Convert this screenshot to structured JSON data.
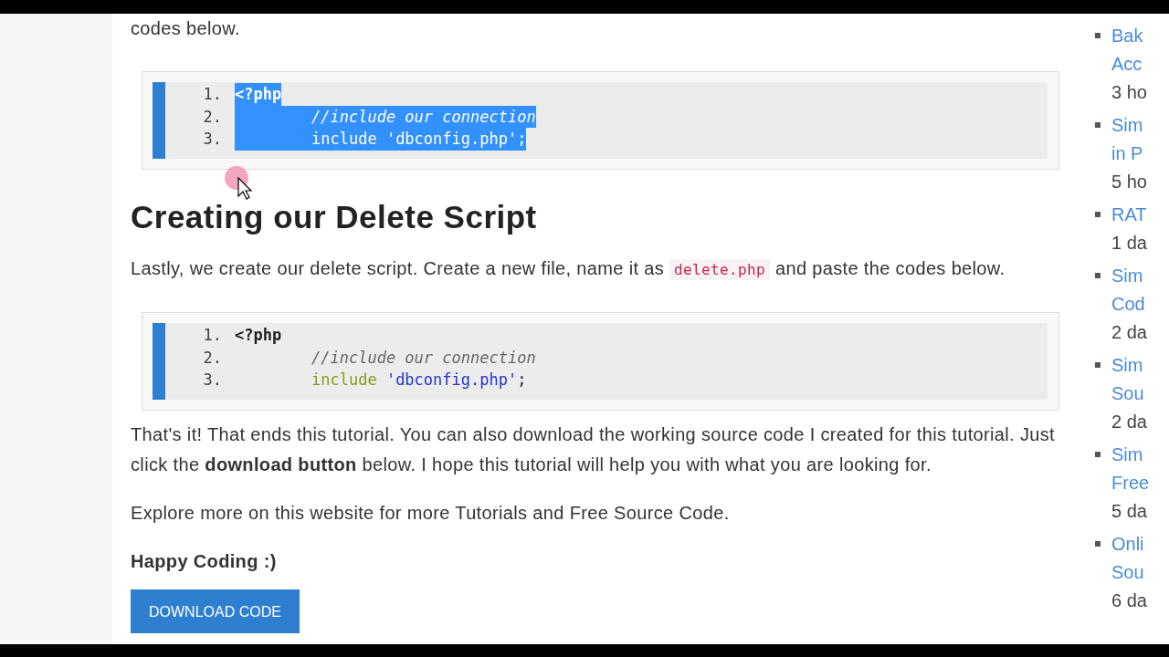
{
  "intro_tail": "codes below.",
  "code_blocks": [
    {
      "lines": [
        {
          "number": "1.",
          "selected": true,
          "kind": "opening",
          "tokens": [
            {
              "kind": "tag",
              "text": "<?php"
            }
          ]
        },
        {
          "number": "2.",
          "selected": true,
          "kind": "statement",
          "tokens": [
            {
              "kind": "comment",
              "text": "//include our connection"
            }
          ]
        },
        {
          "number": "3.",
          "selected": true,
          "kind": "statement",
          "tokens": [
            {
              "kind": "keyword",
              "text": "include "
            },
            {
              "kind": "string",
              "text": "'dbconfig.php'"
            },
            {
              "kind": "plain",
              "text": ";"
            }
          ]
        }
      ]
    },
    {
      "lines": [
        {
          "number": "1.",
          "selected": false,
          "kind": "opening",
          "tokens": [
            {
              "kind": "tag",
              "text": "<?php"
            }
          ]
        },
        {
          "number": "2.",
          "selected": false,
          "kind": "statement",
          "tokens": [
            {
              "kind": "comment",
              "text": "//include our connection"
            }
          ]
        },
        {
          "number": "3.",
          "selected": false,
          "kind": "statement",
          "tokens": [
            {
              "kind": "keyword",
              "text": "include "
            },
            {
              "kind": "string",
              "text": "'dbconfig.php'"
            },
            {
              "kind": "plain",
              "text": ";"
            }
          ]
        }
      ]
    }
  ],
  "heading": "Creating our Delete Script",
  "paragraph_before": "Lastly, we create our delete script. Create a new file, name it as",
  "inline_code": "delete.php",
  "paragraph_after": "and paste the codes below.",
  "closing_paragraph": "That's it! That ends this tutorial. You can also download the working source code I created for this tutorial. Just click the **download button** below. I hope this tutorial will help you with what you are looking for.",
  "explore": "Explore more on this website for more Tutorials and Free Source Code.",
  "sign_off": "Happy Coding :)",
  "download_button": "DOWNLOAD CODE",
  "sidebar": [
    {
      "title_lines": [
        "Bak",
        "Acc"
      ],
      "time": "3 ho"
    },
    {
      "title_lines": [
        "Sim",
        "in P"
      ],
      "time": "5 ho"
    },
    {
      "title_lines": [
        "RAT"
      ],
      "time": "1 da"
    },
    {
      "title_lines": [
        "Sim",
        "Cod"
      ],
      "time": "2 da"
    },
    {
      "title_lines": [
        "Sim",
        "Sou"
      ],
      "time": "2 da"
    },
    {
      "title_lines": [
        "Sim",
        "Free"
      ],
      "time": "5 da"
    },
    {
      "title_lines": [
        "Onli",
        "Sou"
      ],
      "time": "6 da"
    }
  ]
}
